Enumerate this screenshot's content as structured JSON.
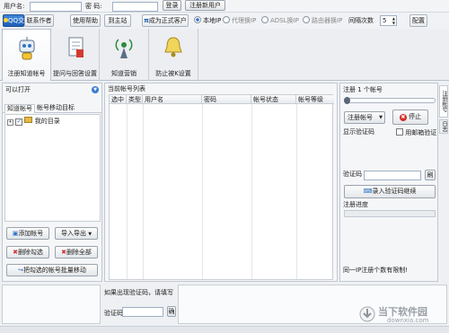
{
  "login_bar": {
    "username_label": "用户名:",
    "password_label": "密  码:",
    "login_button": "登录",
    "register_button": "注册新用户"
  },
  "toolbar": {
    "qq_button": "QQ交谈",
    "contact_author": "联系作者",
    "help": "使用帮助",
    "homepage": "到主站",
    "become_customer": "成为正式客户",
    "radio_local": "本地IP",
    "radio_proxy": "代理换IP",
    "radio_adsl": "ADSL换IP",
    "radio_router": "路由器换IP",
    "retry_label": "间隔次数",
    "retry_value": "5",
    "config_button": "配置"
  },
  "main_tabs": [
    {
      "label": "注册知道帐号",
      "icon": "robot-icon"
    },
    {
      "label": "提问与回答设置",
      "icon": "document-icon"
    },
    {
      "label": "知道营销",
      "icon": "radio-tower-icon"
    },
    {
      "label": "防止被K设置",
      "icon": "bell-icon"
    }
  ],
  "left_panel": {
    "header": "可以打开",
    "tab_accounts": "知道帐号",
    "tab_move": "帐号移动目标",
    "tree_root": "我的目录",
    "add_account": "添加帐号",
    "import_export": "导入导出",
    "delete_selected": "删除勾选",
    "delete_all": "删除全部",
    "batch_move": "把勾选的帐号批量移动"
  },
  "account_list": {
    "header": "当前帐号列表",
    "columns": [
      "选中",
      "类型",
      "用户名",
      "密码",
      "帐号状态",
      "帐号等级"
    ]
  },
  "right_panel": {
    "title": "注册 1 个帐号",
    "register_dropdown": "注册帐号",
    "stop_button": "停止",
    "show_captcha": "显示验证码",
    "use_email_verify": "用邮箱验证",
    "captcha_label": "验证码",
    "refresh_button": "刷",
    "input_captcha_button": "录入验证码继续",
    "progress_label": "注册进度",
    "notice": "同一IP注册个数有限制!",
    "side_tab_1": "注册帐号",
    "side_tab_2": "日志"
  },
  "bottom": {
    "captcha_prompt": "如果出现验证码，请填写",
    "captcha_label": "验证码",
    "ok_button": "确"
  },
  "watermark": {
    "name": "当下软件园",
    "url": "downxia.com"
  }
}
